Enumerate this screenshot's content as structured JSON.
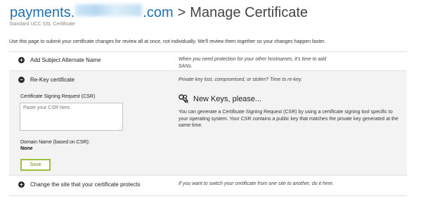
{
  "header": {
    "domain_prefix": "payments.",
    "domain_suffix": ".com",
    "separator": ">",
    "title": "Manage Certificate",
    "subtitle": "Standard UCC SSL Certificate"
  },
  "intro_text": "Use this page to submit your certificate changes for review all at once, not individually. We'll review them together so your changes happen faster.",
  "rows": [
    {
      "toggle": "+",
      "label": "Add Subject Alternate Name",
      "description": "When you need protection for your other hostnames, it's time to add SANs."
    },
    {
      "toggle": "−",
      "label": "Re-Key certificate",
      "description": "Private key lost, compromised, or stolen? Time to re-key."
    },
    {
      "toggle": "+",
      "label": "Change the site that your certificate protects",
      "description": "If you want to switch your certificate from one site to another, do it here."
    }
  ],
  "rekey_form": {
    "csr_label": "Certificate Signing Request (CSR)",
    "csr_placeholder": "Paste your CSR here.",
    "csr_value": "",
    "domain_label": "Domain Name (based on CSR):",
    "domain_value": "None",
    "save_label": "Save"
  },
  "new_keys": {
    "icon": "key-icon",
    "title": "New Keys, please...",
    "description": "You can generate a Certificate Signing Request (CSR) by using a certificate signing tool specific to your operating system. Your CSR contains a public key that matches the private key generated at the same time."
  },
  "colors": {
    "link": "#1f6fb5",
    "save_border": "#9cbf3c",
    "expanded_bg": "#f3f3f3"
  }
}
